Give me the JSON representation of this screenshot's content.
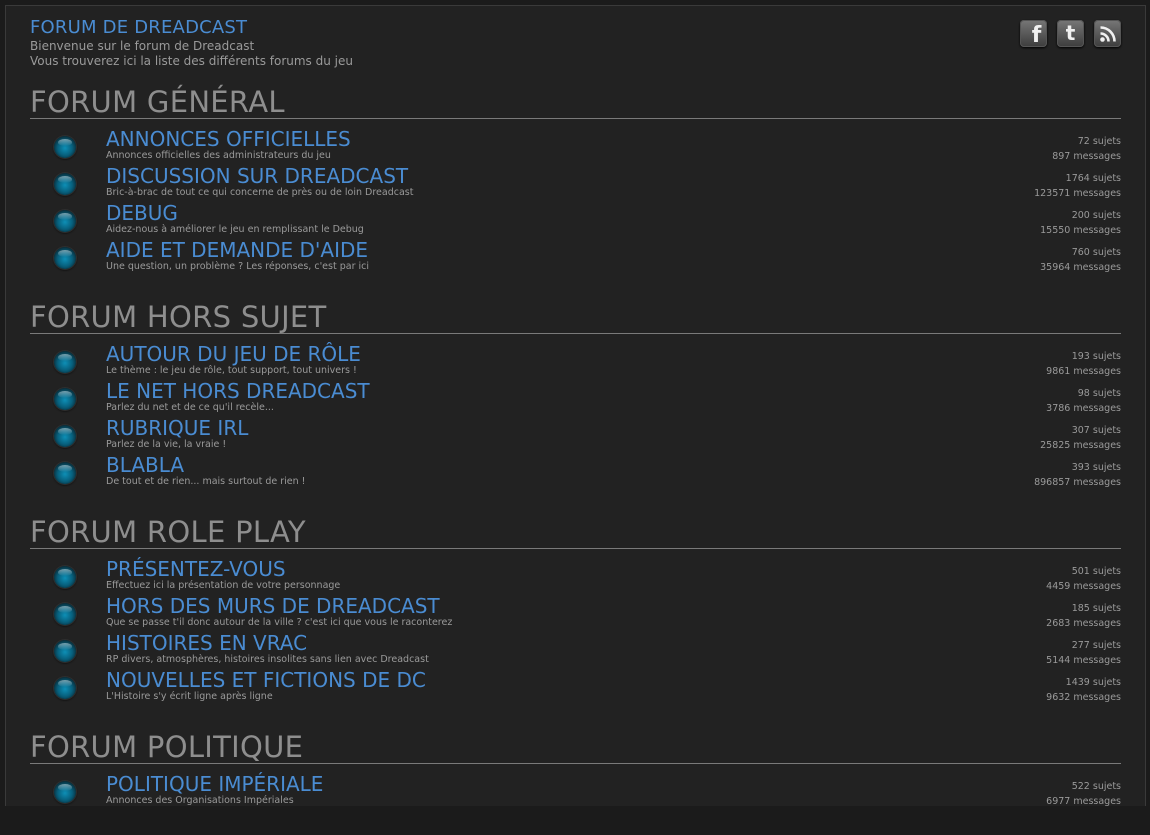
{
  "header": {
    "title": "FORUM DE DREADCAST",
    "line1": "Bienvenue sur le forum de Dreadcast",
    "line2": "Vous trouverez ici la liste des différents forums du jeu"
  },
  "social": {
    "facebook": "f",
    "twitter": "t"
  },
  "categories": [
    {
      "title": "FORUM GÉNÉRAL",
      "forums": [
        {
          "name": "ANNONCES OFFICIELLES",
          "desc": "Annonces officielles des administrateurs du jeu",
          "sujets": "72 sujets",
          "messages": "897 messages"
        },
        {
          "name": "DISCUSSION SUR DREADCAST",
          "desc": "Bric-à-brac de tout ce qui concerne de près ou de loin Dreadcast",
          "sujets": "1764 sujets",
          "messages": "123571 messages"
        },
        {
          "name": "DEBUG",
          "desc": "Aidez-nous à améliorer le jeu en remplissant le Debug",
          "sujets": "200 sujets",
          "messages": "15550 messages"
        },
        {
          "name": "AIDE ET DEMANDE D'AIDE",
          "desc": "Une question, un problème ? Les réponses, c'est par ici",
          "sujets": "760 sujets",
          "messages": "35964 messages"
        }
      ]
    },
    {
      "title": "FORUM HORS SUJET",
      "forums": [
        {
          "name": "AUTOUR DU JEU DE RÔLE",
          "desc": "Le thème : le jeu de rôle, tout support, tout univers !",
          "sujets": "193 sujets",
          "messages": "9861 messages"
        },
        {
          "name": "LE NET HORS DREADCAST",
          "desc": "Parlez du net et de ce qu'il recèle...",
          "sujets": "98 sujets",
          "messages": "3786 messages"
        },
        {
          "name": "RUBRIQUE IRL",
          "desc": "Parlez de la vie, la vraie !",
          "sujets": "307 sujets",
          "messages": "25825 messages"
        },
        {
          "name": "BLABLA",
          "desc": "De tout et de rien... mais surtout de rien !",
          "sujets": "393 sujets",
          "messages": "896857 messages"
        }
      ]
    },
    {
      "title": "FORUM ROLE PLAY",
      "forums": [
        {
          "name": "PRÉSENTEZ-VOUS",
          "desc": "Effectuez ici la présentation de votre personnage",
          "sujets": "501 sujets",
          "messages": "4459 messages"
        },
        {
          "name": "HORS DES MURS DE DREADCAST",
          "desc": "Que se passe t'il donc autour de la ville ? c'est ici que vous le raconterez",
          "sujets": "185 sujets",
          "messages": "2683 messages"
        },
        {
          "name": "HISTOIRES EN VRAC",
          "desc": "RP divers, atmosphères, histoires insolites sans lien avec Dreadcast",
          "sujets": "277 sujets",
          "messages": "5144 messages"
        },
        {
          "name": "NOUVELLES ET FICTIONS DE DC",
          "desc": "L'Histoire s'y écrit ligne après ligne",
          "sujets": "1439 sujets",
          "messages": "9632 messages"
        }
      ]
    },
    {
      "title": "FORUM POLITIQUE",
      "forums": [
        {
          "name": "POLITIQUE IMPÉRIALE",
          "desc": "Annonces des Organisations Impériales",
          "sujets": "522 sujets",
          "messages": "6977 messages"
        }
      ]
    }
  ]
}
